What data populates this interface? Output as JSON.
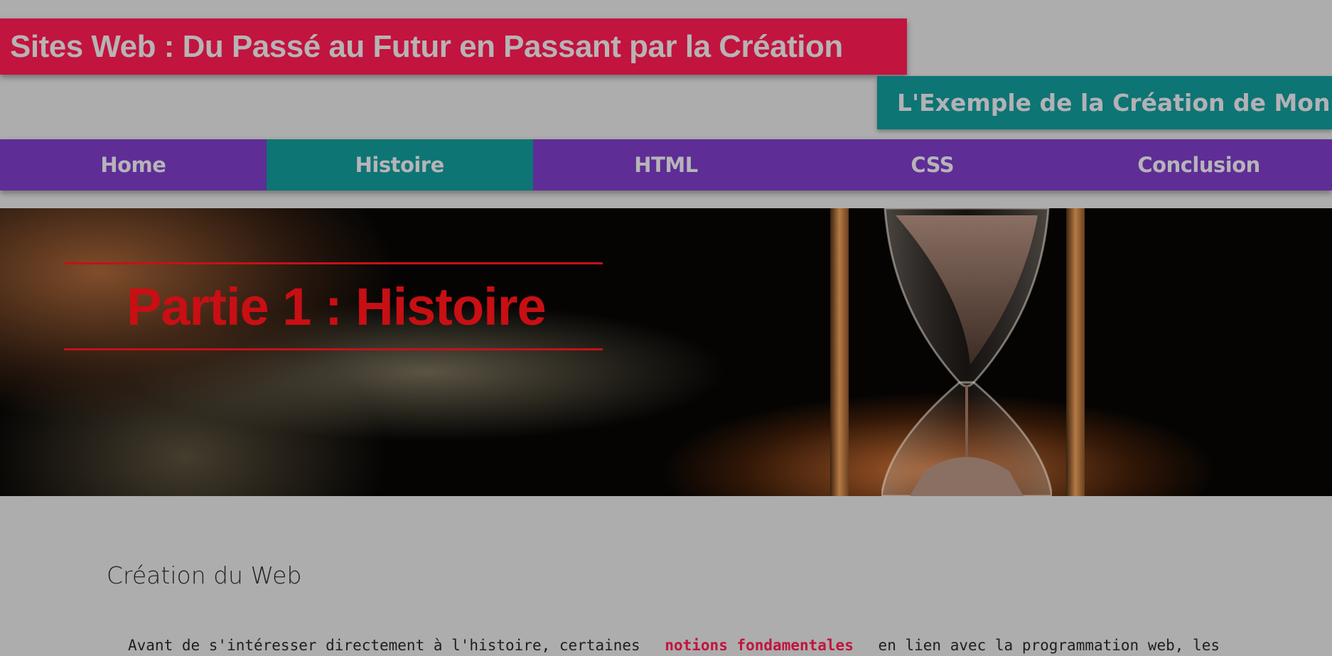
{
  "header": {
    "site_title": "Sites Web : Du Passé au Futur en Passant par la Création",
    "subtitle": "L'Exemple de la Création de Mon Site"
  },
  "nav": {
    "items": [
      {
        "label": "Home"
      },
      {
        "label": "Histoire",
        "active": true
      },
      {
        "label": "HTML"
      },
      {
        "label": "CSS"
      },
      {
        "label": "Conclusion"
      }
    ]
  },
  "hero": {
    "heading": "Partie 1 : Histoire",
    "image": "hourglass-on-book-image"
  },
  "content": {
    "section_title": "Création du Web",
    "intro_before": "Avant de s'intéresser directement à l'histoire, certaines",
    "intro_highlight": "notions fondamentales",
    "intro_after": "en lien avec la programmation web, les"
  },
  "colors": {
    "title_bar": "#c1143f",
    "subtitle_bar": "#0d7574",
    "nav_bar": "#5e2d96",
    "nav_active": "#0d7574",
    "hero_heading": "#c80f14",
    "background": "#adadad"
  }
}
